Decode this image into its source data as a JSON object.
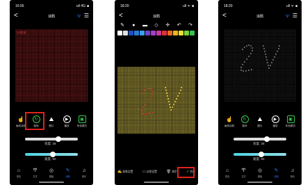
{
  "phones": [
    {
      "status": {
        "time": "16:55",
        "signal": "ull 4G",
        "battery": "■"
      },
      "nav": {
        "back": "<",
        "title": "涂鸦",
        "wifi": "wifi-icon",
        "menu": "menu-icon"
      },
      "panel_label": "二0发出",
      "modes": [
        {
          "icon": "hand-touch-icon",
          "label": "画线涂鸦"
        },
        {
          "icon": "rotate-icon",
          "label": "旋转"
        },
        {
          "icon": "image-icon",
          "label": "图片"
        },
        {
          "icon": "play-icon",
          "label": "播放"
        },
        {
          "icon": "effect-icon",
          "label": "彩色模式"
        }
      ],
      "brightness": {
        "label": "亮度",
        "value": "28",
        "fraction": 0.62
      },
      "speed": {
        "label": "速度",
        "value": "50",
        "fraction": 0.5
      },
      "tabs": [
        {
          "icon": "home-icon",
          "label": "首页"
        },
        {
          "icon": "text-icon",
          "label": "文字"
        },
        {
          "icon": "template-icon",
          "label": "模板"
        },
        {
          "icon": "draw-icon",
          "label": "涂鸦"
        },
        {
          "icon": "music-icon",
          "label": "音乐"
        }
      ],
      "active_tab": 3
    },
    {
      "status": {
        "time": "18:20",
        "signal": "ull ᯤ",
        "battery": "■"
      },
      "nav": {
        "back": "<",
        "title": "涂鸦"
      },
      "tools": [
        "✎",
        "●",
        "▬",
        "◇",
        "✛",
        "↶",
        "↷"
      ],
      "palette": [
        "#ffffff",
        "#e0e0e0",
        "#1e4fbf",
        "#2a7bd6",
        "#3aa0e8",
        "#7a3fd0",
        "#a040c8",
        "#c83c9a",
        "#e0303a",
        "#e86c24",
        "#f0b420",
        "#e8e030",
        "#7ad040",
        "#38c050"
      ],
      "bottom_tools": [
        {
          "icon": "pen-icon",
          "label": "画笔设置"
        },
        {
          "icon": "color-icon",
          "label": "边框设置"
        },
        {
          "icon": "delete-icon",
          "label": "清空"
        },
        {
          "icon": "check-icon",
          "label": "完成"
        }
      ]
    },
    {
      "status": {
        "time": "18:20",
        "signal": "ull ᯤ",
        "battery": "■"
      },
      "nav": {
        "back": "<",
        "title": "涂鸦",
        "wifi": "wifi-icon",
        "menu": "menu-icon"
      },
      "modes": [
        {
          "icon": "hand-touch-icon",
          "label": "画线涂鸦"
        },
        {
          "icon": "rotate-icon",
          "label": "旋转"
        },
        {
          "icon": "image-icon",
          "label": "图片"
        },
        {
          "icon": "play-icon",
          "label": "播放"
        },
        {
          "icon": "effect-icon",
          "label": "彩色模式"
        }
      ],
      "brightness": {
        "label": "亮度",
        "value": "28",
        "fraction": 0.62
      },
      "speed": {
        "label": "速度",
        "value": "50",
        "fraction": 0.5
      },
      "tabs": [
        {
          "icon": "home-icon",
          "label": "首页"
        },
        {
          "icon": "text-icon",
          "label": "文字"
        },
        {
          "icon": "template-icon",
          "label": "模板"
        },
        {
          "icon": "draw-icon",
          "label": "涂鸦"
        },
        {
          "icon": "music-icon",
          "label": "音乐"
        }
      ],
      "active_tab": 3
    }
  ],
  "colors": {
    "highlight": "#e0241b",
    "accent": "#2b7cff",
    "led_red": "#b0282a",
    "led_yellow": "#b8a42e"
  }
}
